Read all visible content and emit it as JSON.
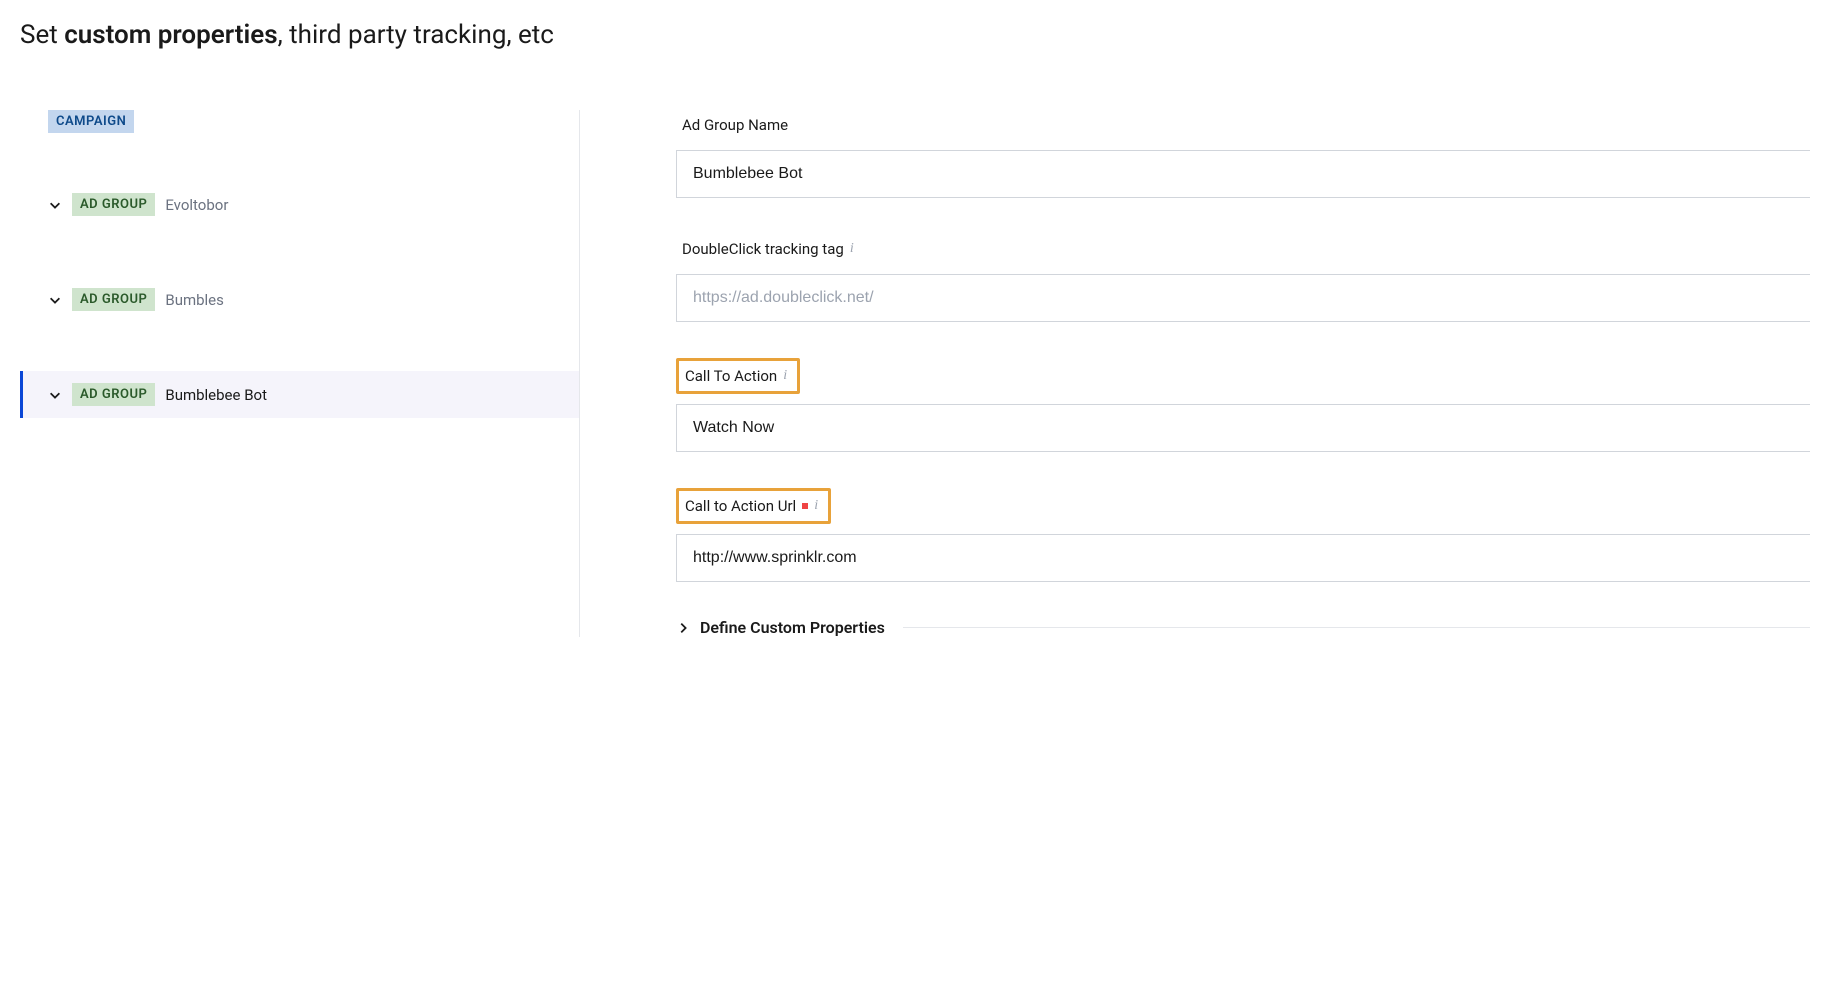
{
  "header": {
    "title_prefix": "Set ",
    "title_bold": "custom properties",
    "title_suffix": ", third party tracking, etc"
  },
  "sidebar": {
    "campaign_badge": "CAMPAIGN",
    "adgroup_badge": "AD GROUP",
    "items": [
      {
        "label": "Evoltobor",
        "selected": false
      },
      {
        "label": "Bumbles",
        "selected": false
      },
      {
        "label": "Bumblebee Bot",
        "selected": true
      }
    ]
  },
  "form": {
    "ad_group_name": {
      "label": "Ad Group Name",
      "value": "Bumblebee Bot"
    },
    "tracking_tag": {
      "label": "DoubleClick tracking tag",
      "placeholder": "https://ad.doubleclick.net/",
      "value": ""
    },
    "call_to_action": {
      "label": "Call To Action",
      "value": "Watch Now"
    },
    "cta_url": {
      "label": "Call to Action Url",
      "value": "http://www.sprinklr.com"
    },
    "custom_props": {
      "label": "Define Custom Properties"
    }
  }
}
